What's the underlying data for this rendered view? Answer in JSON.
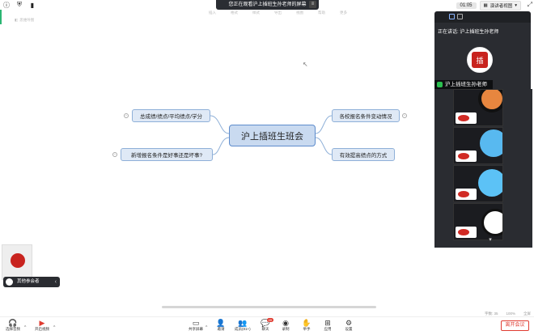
{
  "share_banner": {
    "text": "您正在观看沪上插班生孙老师的屏幕"
  },
  "top_right": {
    "time": "01:05",
    "view_label": "演讲者视图"
  },
  "canvas": {
    "doc_tab": "思维导图",
    "toolbar": [
      "插入",
      "格式",
      "样式",
      "导出",
      "视图",
      "帮助",
      "更多"
    ]
  },
  "mindmap": {
    "center": "沪上插班生班会",
    "left_nodes": [
      "总成绩/绩点/平均绩点/学分",
      "新增报名条件是好事还是坏事?"
    ],
    "right_nodes": [
      "各校报名条件变动情况",
      "有效提高绩点的方式"
    ]
  },
  "right_panel": {
    "speaking_label": "正在讲话: 沪上插班生孙老师",
    "speaker_name": "沪上插班生孙老师",
    "avatar_text": "插"
  },
  "mini": {
    "label": "其他参会者"
  },
  "status_right": [
    "字数: 35",
    "100%",
    "全屏"
  ],
  "toolbar": {
    "items": [
      {
        "label": "选择音频",
        "icon": "headset-icon"
      },
      {
        "label": "开启视频",
        "icon": "camera-off-icon"
      },
      {
        "label": "共享屏幕",
        "icon": "share-screen-icon"
      },
      {
        "label": "邀请",
        "icon": "invite-icon"
      },
      {
        "label": "成员(81+)",
        "icon": "members-icon"
      },
      {
        "label": "聊天",
        "icon": "chat-icon",
        "badge": "49"
      },
      {
        "label": "录制",
        "icon": "record-icon"
      },
      {
        "label": "举手",
        "icon": "raise-hand-icon"
      },
      {
        "label": "应用",
        "icon": "apps-icon"
      },
      {
        "label": "设置",
        "icon": "settings-icon"
      }
    ],
    "leave_label": "离开会议"
  },
  "colors": {
    "accent": "#2bb673",
    "leave": "#e03c31",
    "node_fill": "#dfe9f6",
    "node_border": "#8fb0d8"
  }
}
